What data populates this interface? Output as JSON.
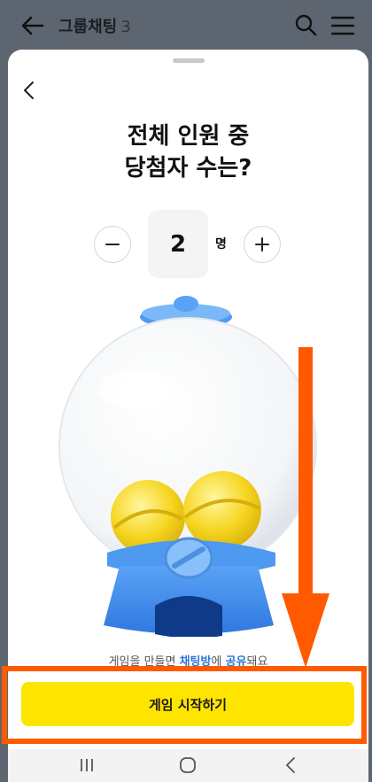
{
  "header": {
    "title": "그룹채팅",
    "member_count": "3",
    "back_icon": "arrow-left-icon",
    "search_icon": "search-icon",
    "menu_icon": "hamburger-menu-icon"
  },
  "sheet": {
    "back_icon": "chevron-left-icon",
    "headline_line1": "전체 인원 중",
    "headline_line2": "당첨자 수는?",
    "stepper": {
      "value": "2",
      "unit": "명",
      "minus_icon": "minus-icon",
      "plus_icon": "plus-icon"
    },
    "share_note": {
      "prefix": "게임을 만들면 ",
      "link1": "채팅방",
      "middle": "에 ",
      "link2": "공유",
      "suffix": "돼요"
    },
    "start_button": "게임 시작하기"
  },
  "colors": {
    "accent_yellow": "#fee500",
    "link_blue": "#2a77d6",
    "annotation_orange": "#ff5a00"
  },
  "navbar": {
    "recent_icon": "recent-apps-icon",
    "home_icon": "home-icon",
    "back_icon": "nav-back-icon"
  }
}
